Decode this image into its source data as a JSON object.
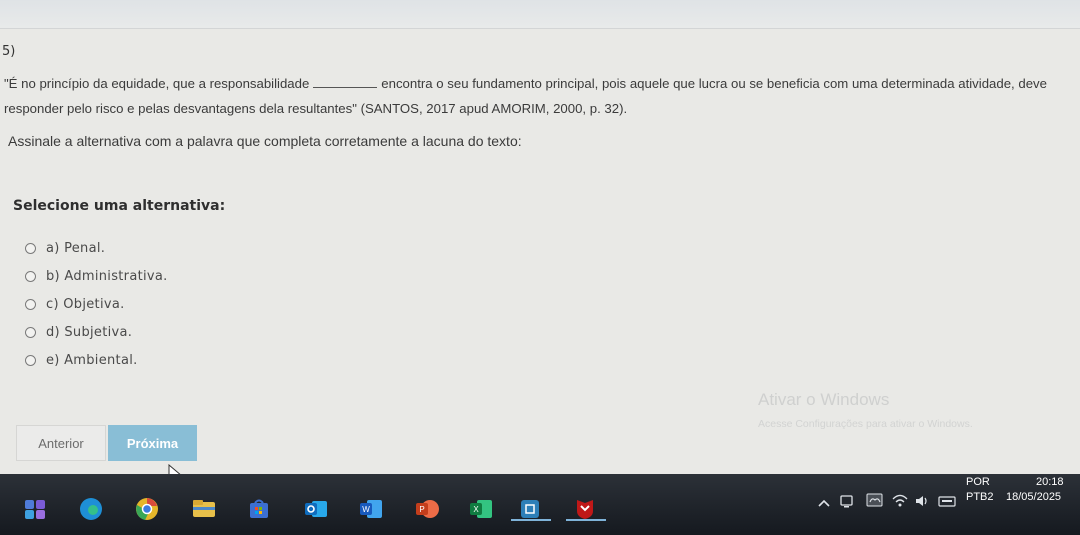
{
  "question": {
    "number": "5)",
    "quote_part1": "\"É no princípio da equidade, que a responsabilidade",
    "quote_part2": "encontra o seu fundamento principal, pois aquele que lucra ou se beneficia com uma determinada atividade, deve responder pelo risco e pelas desvantagens dela resultantes\" (SANTOS, 2017 apud AMORIM, 2000, p. 32).",
    "instruction": "Assinale a alternativa com a palavra que completa corretamente a lacuna do texto:"
  },
  "select_title": "Selecione uma alternativa:",
  "options": [
    {
      "label": "a) Penal."
    },
    {
      "label": "b) Administrativa."
    },
    {
      "label": "c) Objetiva."
    },
    {
      "label": "d) Subjetiva."
    },
    {
      "label": "e) Ambiental."
    }
  ],
  "buttons": {
    "previous": "Anterior",
    "next": "Próxima"
  },
  "watermark": {
    "title": "Ativar o Windows",
    "subtitle": "Acesse Configurações para ativar o Windows."
  },
  "taskbar": {
    "icons": [
      "app-icon",
      "edge-icon",
      "chrome-icon",
      "file-explorer-icon",
      "store-icon",
      "outlook-icon",
      "word-icon",
      "powerpoint-icon",
      "excel-icon",
      "app-icon",
      "mcafee-icon"
    ],
    "language_top": "POR",
    "language_bottom": "PTB2",
    "time": "20:18",
    "date": "18/05/2025"
  },
  "colors": {
    "next_button": "#89bed6",
    "taskbar": "#1c2027"
  }
}
